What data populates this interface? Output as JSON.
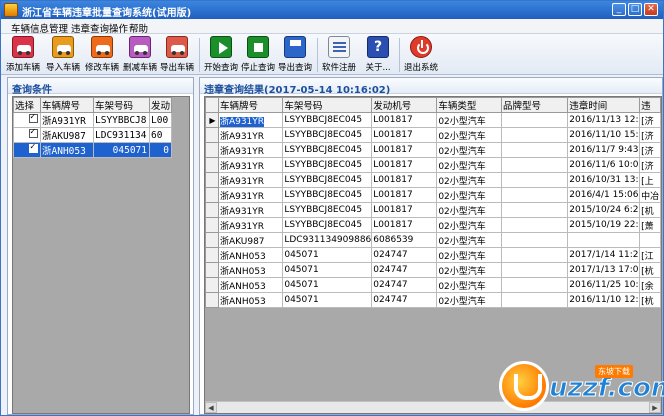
{
  "window": {
    "title": "浙江省车辆违章批量查询系统(试用版)",
    "min_symbol": "_",
    "max_symbol": "□",
    "close_symbol": "✕"
  },
  "menu": [
    "车辆信息管理",
    "违章查询操作",
    "帮助"
  ],
  "toolbar": [
    {
      "label": "添加车辆",
      "icon": "car-add-icon"
    },
    {
      "label": "导入车辆",
      "icon": "car-import-icon"
    },
    {
      "label": "修改车辆",
      "icon": "car-edit-icon"
    },
    {
      "label": "删减车辆",
      "icon": "car-delete-icon"
    },
    {
      "label": "导出车辆",
      "icon": "car-export-icon"
    },
    {
      "label": "开始查询",
      "icon": "play-icon"
    },
    {
      "label": "停止查询",
      "icon": "stop-icon"
    },
    {
      "label": "导出查询",
      "icon": "save-icon"
    },
    {
      "label": "软件注册",
      "icon": "register-icon"
    },
    {
      "label": "关于...",
      "icon": "help-icon"
    },
    {
      "label": "退出系统",
      "icon": "power-icon"
    }
  ],
  "help_glyph": "?",
  "left_panel": {
    "title": "查询条件",
    "columns": [
      "选择",
      "车辆牌号",
      "车架号码",
      "发动"
    ],
    "rows": [
      {
        "checked": true,
        "plate": "浙A931YR",
        "frame": "LSYYBBCJ8",
        "engine": "L00"
      },
      {
        "checked": true,
        "plate": "浙AKU987",
        "frame": "LDC931134",
        "engine": "60"
      },
      {
        "checked": true,
        "plate": "浙ANH053",
        "frame": "045071",
        "engine": "0"
      }
    ]
  },
  "right_panel": {
    "title": "违章查询结果(2017-05-14 10:16:02)",
    "columns": [
      "车辆牌号",
      "车架号码",
      "发动机号",
      "车辆类型",
      "品牌型号",
      "违章时间",
      "违"
    ],
    "rows": [
      [
        "浙A931YR",
        "LSYYBBCJ8EC045",
        "L001817",
        "02小型汽车",
        "",
        "2016/11/13 12:",
        "[济"
      ],
      [
        "浙A931YR",
        "LSYYBBCJ8EC045",
        "L001817",
        "02小型汽车",
        "",
        "2016/11/10 15:",
        "[济"
      ],
      [
        "浙A931YR",
        "LSYYBBCJ8EC045",
        "L001817",
        "02小型汽车",
        "",
        "2016/11/7 9:43",
        "[济"
      ],
      [
        "浙A931YR",
        "LSYYBBCJ8EC045",
        "L001817",
        "02小型汽车",
        "",
        "2016/11/6 10:0",
        "[济"
      ],
      [
        "浙A931YR",
        "LSYYBBCJ8EC045",
        "L001817",
        "02小型汽车",
        "",
        "2016/10/31 13:",
        "[上"
      ],
      [
        "浙A931YR",
        "LSYYBBCJ8EC045",
        "L001817",
        "02小型汽车",
        "",
        "2016/4/1 15:06",
        "中冶"
      ],
      [
        "浙A931YR",
        "LSYYBBCJ8EC045",
        "L001817",
        "02小型汽车",
        "",
        "2015/10/24 6:2",
        "[机"
      ],
      [
        "浙A931YR",
        "LSYYBBCJ8EC045",
        "L001817",
        "02小型汽车",
        "",
        "2015/10/19 22:",
        "[萧"
      ],
      [
        "浙AKU987",
        "LDC931134909886",
        "6086539",
        "02小型汽车",
        "",
        "",
        ""
      ],
      [
        "浙ANH053",
        "045071",
        "024747",
        "02小型汽车",
        "",
        "2017/1/14 11:2",
        "[江"
      ],
      [
        "浙ANH053",
        "045071",
        "024747",
        "02小型汽车",
        "",
        "2017/1/13 17:0",
        "[杭"
      ],
      [
        "浙ANH053",
        "045071",
        "024747",
        "02小型汽车",
        "",
        "2016/11/25 10:",
        "[余"
      ],
      [
        "浙ANH053",
        "045071",
        "024747",
        "02小型汽车",
        "",
        "2016/11/10 12:",
        "[杭"
      ]
    ],
    "row_indicator": "▶",
    "scroll_left": "◀",
    "scroll_right": "▶"
  },
  "watermark": {
    "brand": "uzzf.com",
    "tag": "东坡下载"
  }
}
